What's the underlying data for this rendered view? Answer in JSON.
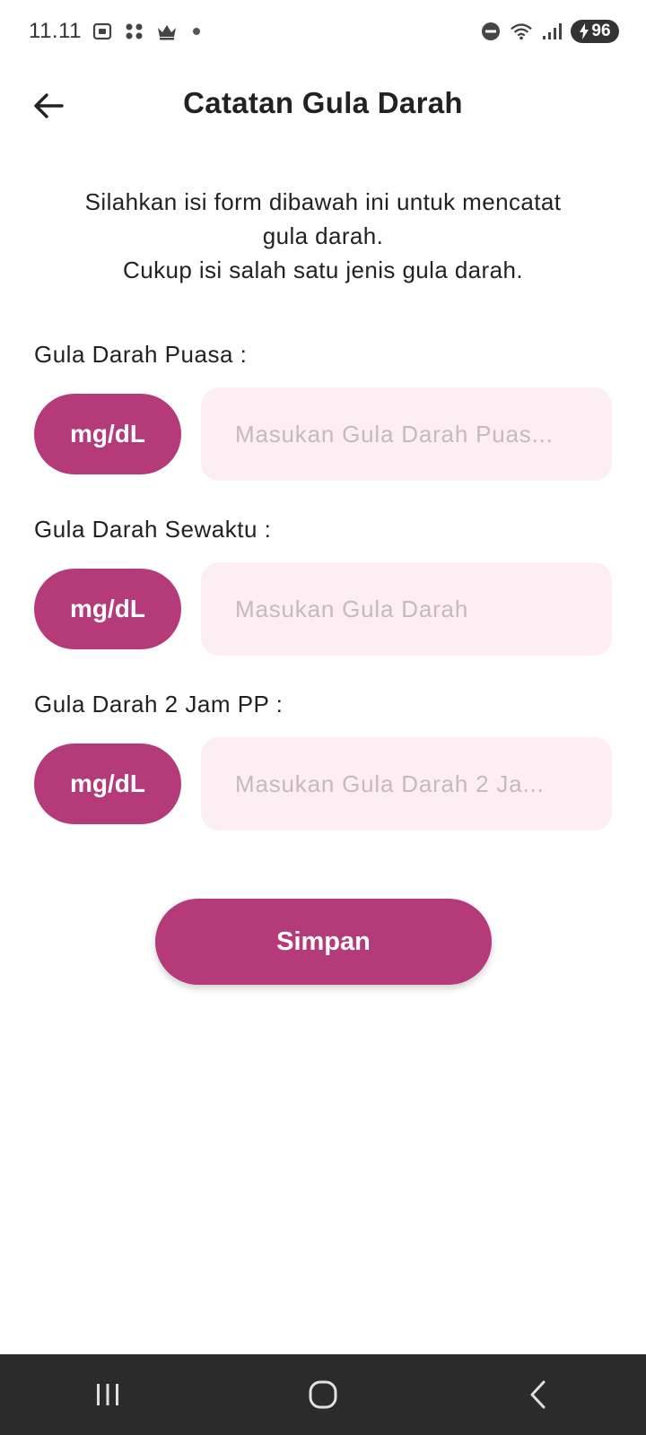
{
  "status_bar": {
    "time": "11.11",
    "battery_level": "96",
    "icons": [
      "screenshot-icon",
      "app-notification-icon",
      "crown-icon",
      "dot-icon",
      "do-not-disturb-icon",
      "wifi-icon",
      "signal-icon",
      "battery-charging-icon"
    ]
  },
  "app_bar": {
    "title": "Catatan Gula Darah",
    "back_icon": "arrow-left-icon"
  },
  "intro": {
    "line1": "Silahkan isi form dibawah ini untuk mencatat",
    "line2": "gula darah.",
    "line3": "Cukup isi salah satu jenis gula darah."
  },
  "fields": [
    {
      "label": "Gula Darah Puasa :",
      "unit": "mg/dL",
      "placeholder": "Masukan Gula Darah Puas...",
      "value": ""
    },
    {
      "label": "Gula Darah Sewaktu :",
      "unit": "mg/dL",
      "placeholder": "Masukan Gula Darah",
      "value": ""
    },
    {
      "label": "Gula Darah 2 Jam PP :",
      "unit": "mg/dL",
      "placeholder": "Masukan Gula Darah 2 Ja...",
      "value": ""
    }
  ],
  "save_button": {
    "label": "Simpan"
  },
  "nav_bar": {
    "icons": [
      "recent-apps-icon",
      "home-icon",
      "back-icon"
    ]
  },
  "colors": {
    "accent": "#b53a7a",
    "input_background": "#fdeef3",
    "placeholder": "#c8b8bf",
    "nav_background": "#2b2b2b"
  }
}
